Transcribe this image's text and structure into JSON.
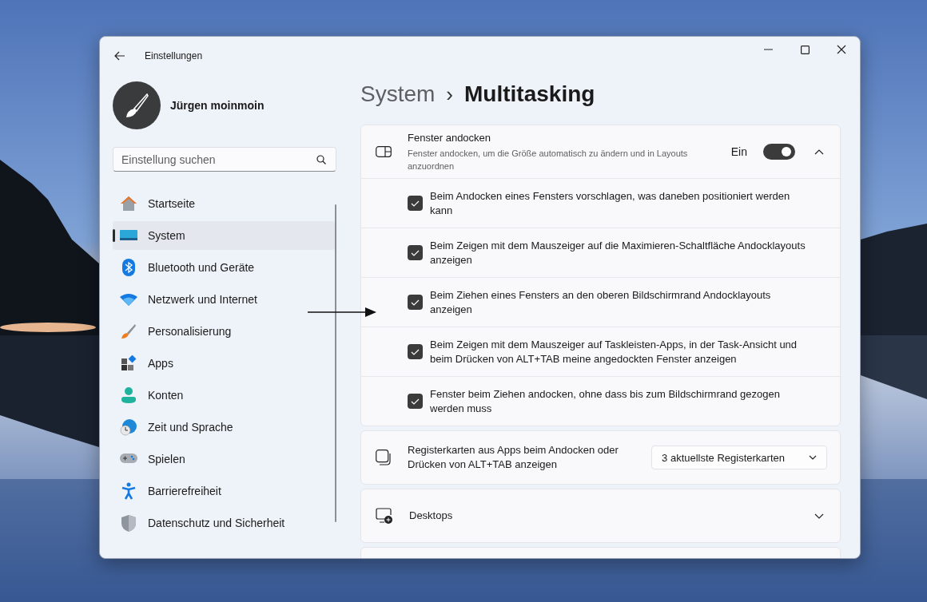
{
  "window": {
    "title": "Einstellungen"
  },
  "user": {
    "name": "Jürgen moinmoin"
  },
  "search": {
    "placeholder": "Einstellung suchen"
  },
  "sidebar": {
    "items": [
      {
        "label": "Startseite",
        "selected": false
      },
      {
        "label": "System",
        "selected": true
      },
      {
        "label": "Bluetooth und Geräte",
        "selected": false
      },
      {
        "label": "Netzwerk und Internet",
        "selected": false
      },
      {
        "label": "Personalisierung",
        "selected": false
      },
      {
        "label": "Apps",
        "selected": false
      },
      {
        "label": "Konten",
        "selected": false
      },
      {
        "label": "Zeit und Sprache",
        "selected": false
      },
      {
        "label": "Spielen",
        "selected": false
      },
      {
        "label": "Barrierefreiheit",
        "selected": false
      },
      {
        "label": "Datenschutz und Sicherheit",
        "selected": false
      }
    ]
  },
  "breadcrumb": {
    "parent": "System",
    "separator": "›",
    "current": "Multitasking"
  },
  "snap": {
    "title": "Fenster andocken",
    "description": "Fenster andocken, um die Größe automatisch zu ändern und in Layouts anzuordnen",
    "toggle_label": "Ein",
    "on": true,
    "expanded": true,
    "options": [
      {
        "label": "Beim Andocken eines Fensters vorschlagen, was daneben positioniert werden kann",
        "checked": true
      },
      {
        "label": "Beim Zeigen mit dem Mauszeiger auf die Maximieren-Schaltfläche Andocklayouts anzeigen",
        "checked": true
      },
      {
        "label": "Beim Ziehen eines Fensters an den oberen Bildschirmrand Andocklayouts anzeigen",
        "checked": true
      },
      {
        "label": "Beim Zeigen mit dem Mauszeiger auf Taskleisten-Apps, in der Task-Ansicht und beim Drücken von ALT+TAB meine angedockten Fenster anzeigen",
        "checked": true
      },
      {
        "label": "Fenster beim Ziehen andocken, ohne dass bis zum Bildschirmrand gezogen werden muss",
        "checked": true
      }
    ]
  },
  "tabs_setting": {
    "label": "Registerkarten aus Apps beim Andocken oder Drücken von ALT+TAB anzeigen",
    "value": "3 aktuellste Registerkarten"
  },
  "desktops": {
    "label": "Desktops",
    "expanded": false
  }
}
